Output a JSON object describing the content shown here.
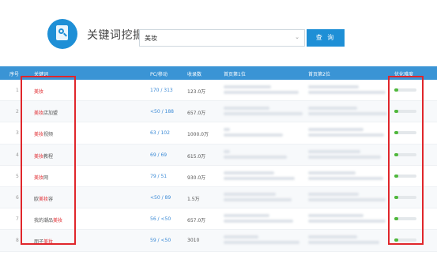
{
  "header": {
    "title": "关键词挖掘",
    "search_value": "美妆",
    "search_button": "查 询"
  },
  "table": {
    "columns": [
      "序号",
      "关键词",
      "PC/移动",
      "收录数",
      "首页第1位",
      "首页第2位",
      "优化难度"
    ],
    "rows": [
      {
        "index": "1",
        "keyword_pre": "",
        "keyword_hl": "美妆",
        "keyword_post": "",
        "pc_mobile": "170 / 313",
        "records": "123.0万",
        "difficulty": 0.18
      },
      {
        "index": "2",
        "keyword_pre": "",
        "keyword_hl": "美妆",
        "keyword_post": "店加盟",
        "pc_mobile": "<50 / 188",
        "records": "657.0万",
        "difficulty": 0.18
      },
      {
        "index": "3",
        "keyword_pre": "",
        "keyword_hl": "美妆",
        "keyword_post": "视频",
        "pc_mobile": "63 / 102",
        "records": "1000.0万",
        "difficulty": 0.18
      },
      {
        "index": "4",
        "keyword_pre": "",
        "keyword_hl": "美妆",
        "keyword_post": "教程",
        "pc_mobile": "69 / 69",
        "records": "615.0万",
        "difficulty": 0.18
      },
      {
        "index": "5",
        "keyword_pre": "",
        "keyword_hl": "美妆",
        "keyword_post": "网",
        "pc_mobile": "79 / 51",
        "records": "930.0万",
        "difficulty": 0.18
      },
      {
        "index": "6",
        "keyword_pre": "欧",
        "keyword_hl": "美妆",
        "keyword_post": "容",
        "pc_mobile": "<50 / 89",
        "records": "1.5万",
        "difficulty": 0.18
      },
      {
        "index": "7",
        "keyword_pre": "我的潮品",
        "keyword_hl": "美妆",
        "keyword_post": "",
        "pc_mobile": "56 / <50",
        "records": "657.0万",
        "difficulty": 0.18
      },
      {
        "index": "8",
        "keyword_pre": "朋子",
        "keyword_hl": "美妆",
        "keyword_post": "",
        "pc_mobile": "59 / <50",
        "records": "3010",
        "difficulty": 0.18
      }
    ]
  },
  "colors": {
    "accent": "#1e8fd6",
    "header_bg": "#3a94d5",
    "highlight": "#e0262b",
    "difficulty": "#4fb83b"
  }
}
